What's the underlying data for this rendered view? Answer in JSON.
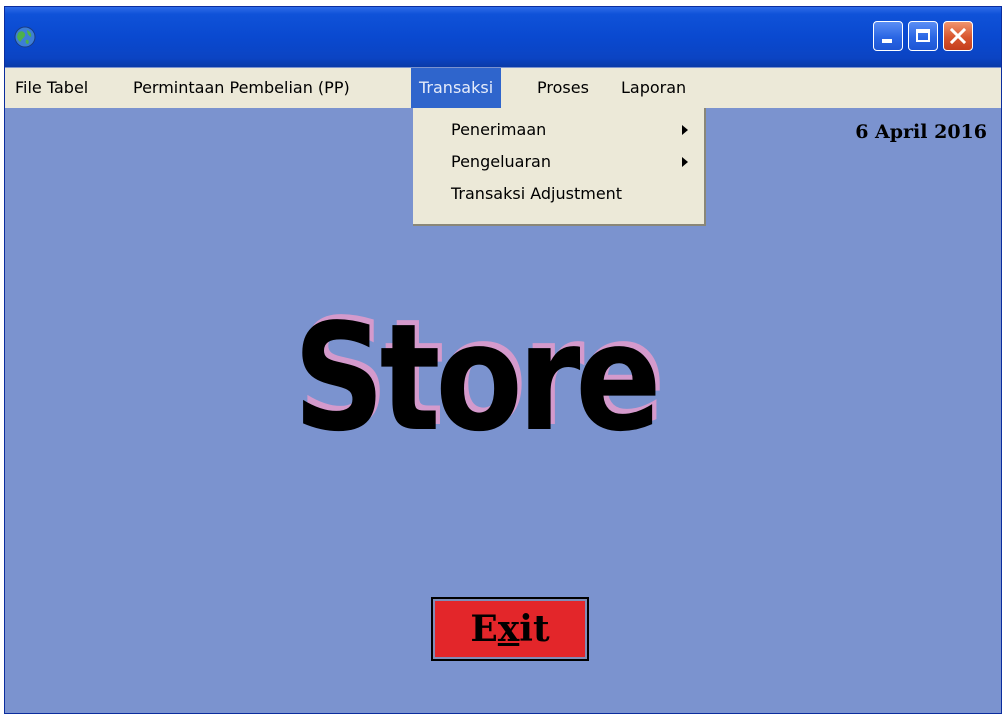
{
  "window": {
    "background_color": "#7B93CF",
    "titlebar_color": "#0A49D0",
    "app_icon": "globe-icon",
    "controls": {
      "minimize_icon": "minimize-icon",
      "maximize_icon": "maximize-icon",
      "close_icon": "close-icon"
    }
  },
  "menubar": {
    "items": [
      {
        "label": "File Tabel",
        "active": false
      },
      {
        "label": "Permintaan Pembelian (PP)",
        "active": false
      },
      {
        "label": "Transaksi",
        "active": true
      },
      {
        "label": "Proses",
        "active": false
      },
      {
        "label": "Laporan",
        "active": false
      }
    ]
  },
  "dropdown": {
    "items": [
      {
        "label": "Penerimaan",
        "has_submenu": true
      },
      {
        "label": "Pengeluaran",
        "has_submenu": true
      },
      {
        "label": "Transaksi Adjustment",
        "has_submenu": false
      }
    ]
  },
  "date": "6 April 2016",
  "main": {
    "title": "Store",
    "title_shadow_color": "#D49ACC"
  },
  "exit_button": {
    "label_first": "E",
    "label_underlined": "x",
    "label_rest": "it",
    "color": "#E3262A"
  }
}
